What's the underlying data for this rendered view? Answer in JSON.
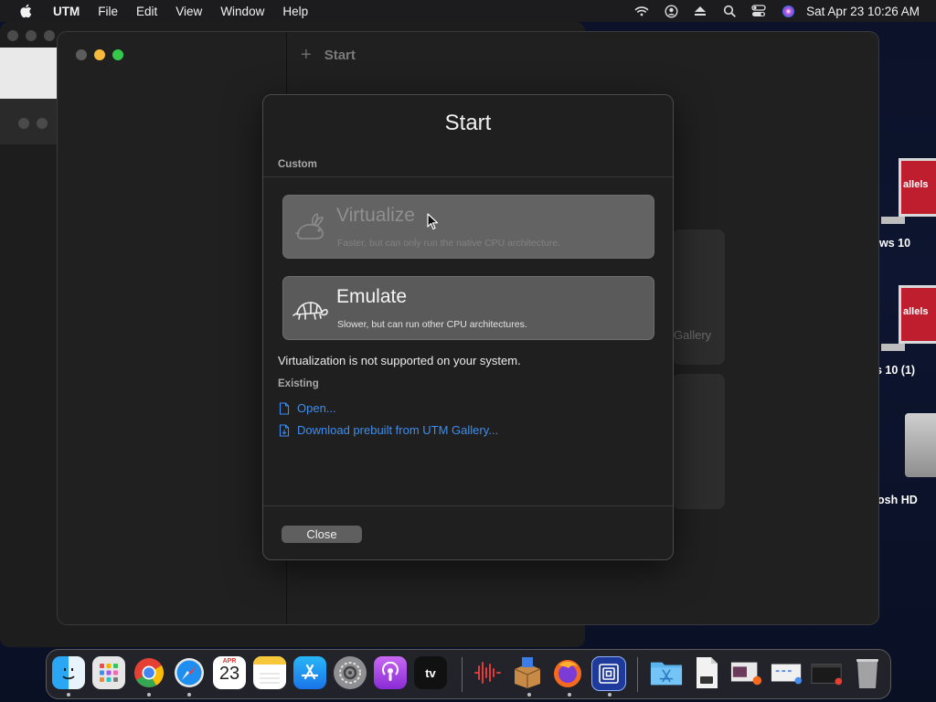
{
  "menubar": {
    "app_name": "UTM",
    "items": [
      "File",
      "Edit",
      "View",
      "Window",
      "Help"
    ],
    "clock": "Sat Apr 23  10:26 AM"
  },
  "desktop": {
    "icons": [
      {
        "label": "ws 10",
        "badge": "allels"
      },
      {
        "label": "s 10 (1)",
        "badge": "allels"
      },
      {
        "label": "osh HD"
      }
    ]
  },
  "utm_window": {
    "toolbar_title": "Start",
    "toolbar_add": "+",
    "bg_card_label": "Gallery"
  },
  "start_sheet": {
    "title": "Start",
    "custom_label": "Custom",
    "virtualize": {
      "title": "Virtualize",
      "description": "Faster, but can only run the native CPU architecture.",
      "enabled": false
    },
    "emulate": {
      "title": "Emulate",
      "description": "Slower, but can run other CPU architectures.",
      "enabled": true
    },
    "notice": "Virtualization is not supported on your system.",
    "existing_label": "Existing",
    "open_link": "Open...",
    "download_link": "Download prebuilt from UTM Gallery...",
    "close_button": "Close"
  },
  "calendar_icon": {
    "month": "APR",
    "day": "23"
  },
  "appletv_label": "tv",
  "dock": {
    "apps": [
      "finder-icon",
      "launchpad-icon",
      "chrome-icon",
      "safari-icon",
      "calendar-icon",
      "notes-icon",
      "app-store-icon",
      "system-preferences-icon",
      "podcasts-icon",
      "apple-tv-icon",
      "audio-editor-icon",
      "archive-utility-icon",
      "firefox-icon",
      "utm-icon",
      "applications-folder-icon",
      "document-icon",
      "screenshot-stack-icon",
      "preview-stack-icon",
      "window-stack-icon",
      "trash-icon"
    ]
  },
  "colors": {
    "link": "#3d8ef0",
    "traffic_close": "#5c5c5c",
    "traffic_min": "#f6b93b",
    "traffic_max": "#35c84a"
  }
}
